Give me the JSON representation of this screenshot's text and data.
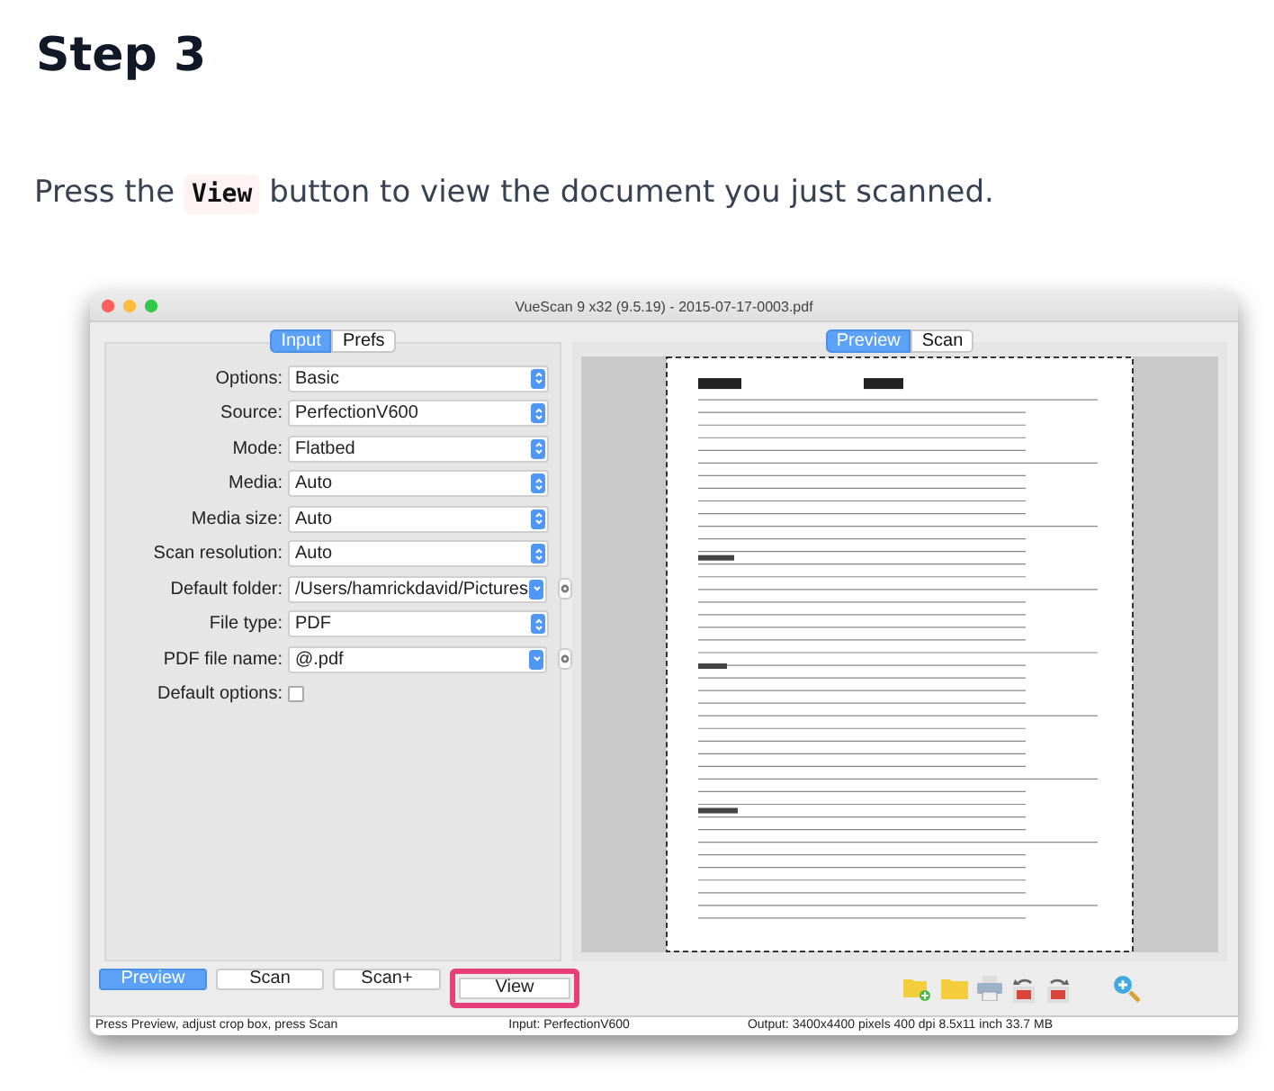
{
  "heading": "Step 3",
  "instruction": {
    "before": "Press the",
    "code": "View",
    "after": "button to view the document you just scanned."
  },
  "window": {
    "title": "VueScan 9 x32 (9.5.19) - 2015-07-17-0003.pdf"
  },
  "left_tabs": [
    {
      "label": "Input",
      "selected": true
    },
    {
      "label": "Prefs",
      "selected": false
    }
  ],
  "settings": [
    {
      "label": "Options:",
      "kind": "select",
      "value": "Basic"
    },
    {
      "label": "Source:",
      "kind": "select",
      "value": "PerfectionV600"
    },
    {
      "label": "Mode:",
      "kind": "select",
      "value": "Flatbed"
    },
    {
      "label": "Media:",
      "kind": "select",
      "value": "Auto"
    },
    {
      "label": "Media size:",
      "kind": "select",
      "value": "Auto"
    },
    {
      "label": "Scan resolution:",
      "kind": "select",
      "value": "Auto"
    },
    {
      "label": "Default folder:",
      "kind": "combo",
      "value": "/Users/hamrickdavid/Pictures"
    },
    {
      "label": "File type:",
      "kind": "select",
      "value": "PDF"
    },
    {
      "label": "PDF file name:",
      "kind": "combo",
      "value": "@.pdf"
    },
    {
      "label": "Default options:",
      "kind": "checkbox",
      "checked": false
    }
  ],
  "preview_tabs": [
    {
      "label": "Preview",
      "selected": true
    },
    {
      "label": "Scan",
      "selected": false
    }
  ],
  "buttons": [
    {
      "label": "Preview",
      "selected": true,
      "highlighted": false
    },
    {
      "label": "Scan",
      "selected": false,
      "highlighted": false
    },
    {
      "label": "Scan+",
      "selected": false,
      "highlighted": false
    },
    {
      "label": "View",
      "selected": false,
      "highlighted": true
    }
  ],
  "status_bar": {
    "left": "Press Preview, adjust crop box, press Scan",
    "center": "Input: PerfectionV600",
    "right": "Output: 3400x4400 pixels 400 dpi 8.5x11 inch 33.7 MB"
  }
}
